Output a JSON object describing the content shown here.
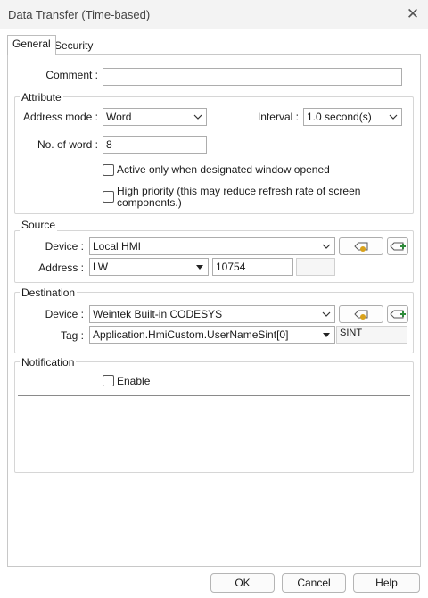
{
  "window": {
    "title": "Data Transfer (Time-based)",
    "close_glyph": "✕"
  },
  "tabs": [
    {
      "label": "General"
    },
    {
      "label": "Security"
    }
  ],
  "general": {
    "comment_label": "Comment :",
    "comment_value": ""
  },
  "attribute": {
    "legend": "Attribute",
    "address_mode_label": "Address mode :",
    "address_mode_value": "Word",
    "interval_label": "Interval :",
    "interval_value": "1.0 second(s)",
    "word_count_label": "No. of word :",
    "word_count_value": "8",
    "active_only_label": "Active only when designated window opened",
    "high_priority_label_line1": "High priority (this may reduce refresh rate of screen",
    "high_priority_label_line2": "components.)"
  },
  "source": {
    "legend": "Source",
    "device_label": "Device :",
    "device_value": "Local HMI",
    "address_label": "Address :",
    "address_type": "LW",
    "address_value": "10754",
    "index_value": ""
  },
  "destination": {
    "legend": "Destination",
    "device_label": "Device :",
    "device_value": "Weintek Built-in CODESYS",
    "tag_label": "Tag :",
    "tag_value": "Application.HmiCustom.UserNameSint[0]",
    "tag_type": "SINT"
  },
  "notification": {
    "legend": "Notification",
    "enable_label": "Enable"
  },
  "buttons": {
    "ok": "OK",
    "cancel": "Cancel",
    "help": "Help"
  },
  "icons": {
    "device_settings": "tag-settings-icon",
    "device_add": "tag-add-icon",
    "dropdown": "chevron-down-icon",
    "close": "close-icon"
  },
  "colors": {
    "accent_green": "#2e8b3a",
    "accent_orange": "#d9a21b"
  }
}
